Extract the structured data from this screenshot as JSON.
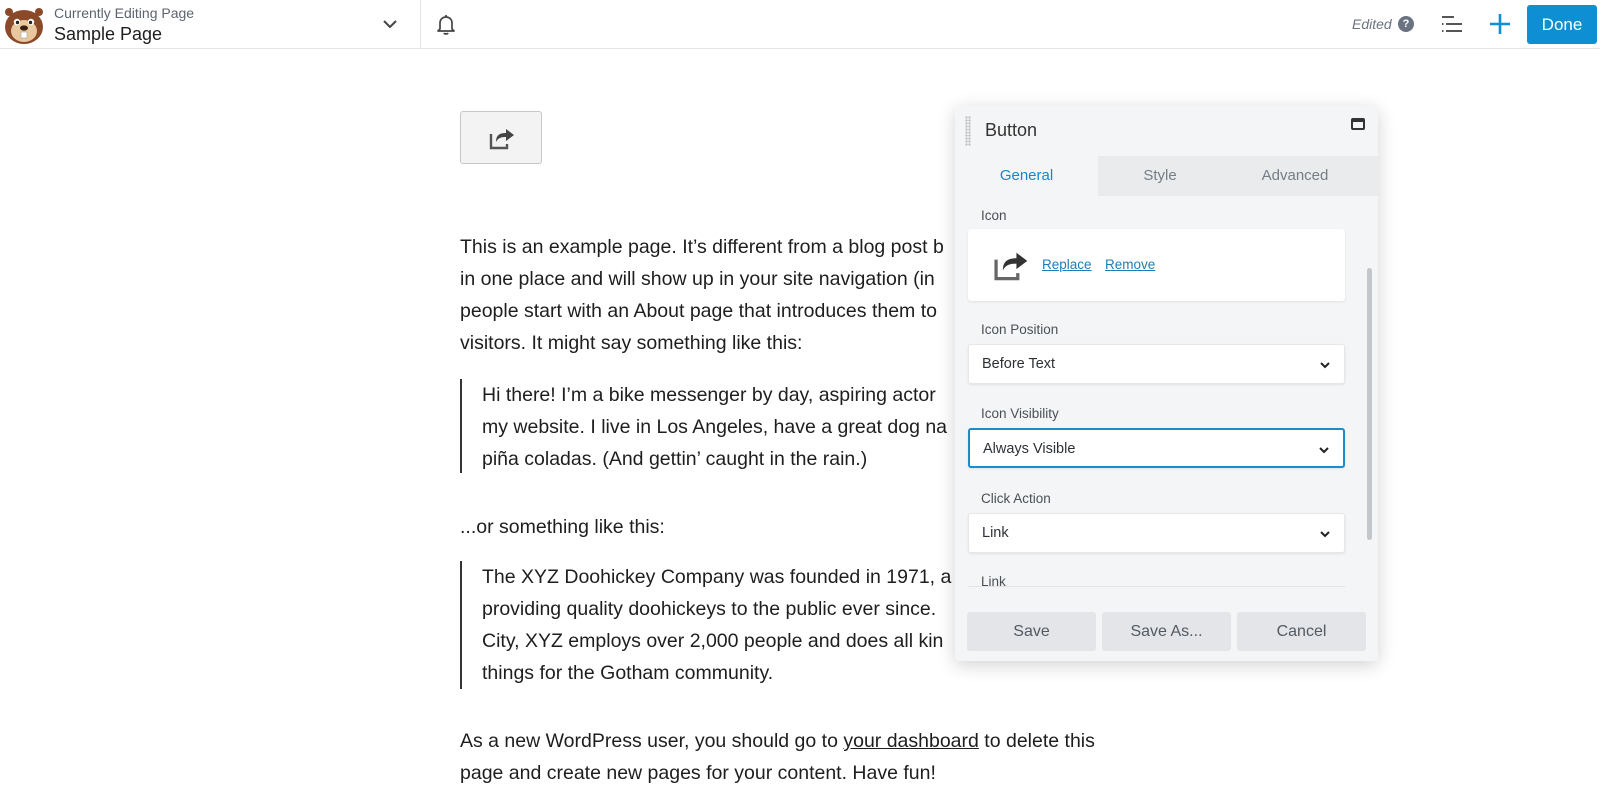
{
  "topbar": {
    "editing_label": "Currently Editing Page",
    "page_name": "Sample Page",
    "status": "Edited",
    "help": "?",
    "done_label": "Done"
  },
  "content": {
    "p1": [
      "This is an example page. It’s different from a blog post b",
      "in one place and will show up in your site navigation (in",
      "people start with an About page that introduces them to",
      "visitors. It might say something like this:"
    ],
    "quote1": [
      "Hi there! I’m a bike messenger by day, aspiring actor",
      "my website. I live in Los Angeles, have a great dog na",
      "piña coladas. (And gettin’ caught in the rain.)"
    ],
    "p2": "...or something like this:",
    "quote2": [
      "The XYZ Doohickey Company was founded in 1971, a",
      "providing quality doohickeys to the public ever since.",
      "City, XYZ employs over 2,000 people and does all kin",
      "things for the Gotham community."
    ],
    "p3_before": "As a new WordPress user, you should go to ",
    "p3_link": "your dashboard",
    "p3_after": " to delete this",
    "p3_line2": "page and create new pages for your content. Have fun!"
  },
  "panel": {
    "title": "Button",
    "tabs": [
      "General",
      "Style",
      "Advanced"
    ],
    "icon_label": "Icon",
    "replace_label": "Replace",
    "remove_label": "Remove",
    "icon_position_label": "Icon Position",
    "icon_position_value": "Before Text",
    "icon_visibility_label": "Icon Visibility",
    "icon_visibility_value": "Always Visible",
    "click_action_label": "Click Action",
    "click_action_value": "Link",
    "link_label": "Link",
    "save_label": "Save",
    "save_as_label": "Save As...",
    "cancel_label": "Cancel"
  },
  "icons": {
    "logo": "beaver-logo",
    "page_dropdown": "chevron-down-icon",
    "notifications": "bell-icon",
    "outline": "outline-list-icon",
    "add": "plus-icon",
    "share": "share-icon"
  },
  "colors": {
    "accent": "#0e8fd4",
    "active_tab": "#1588c5"
  }
}
